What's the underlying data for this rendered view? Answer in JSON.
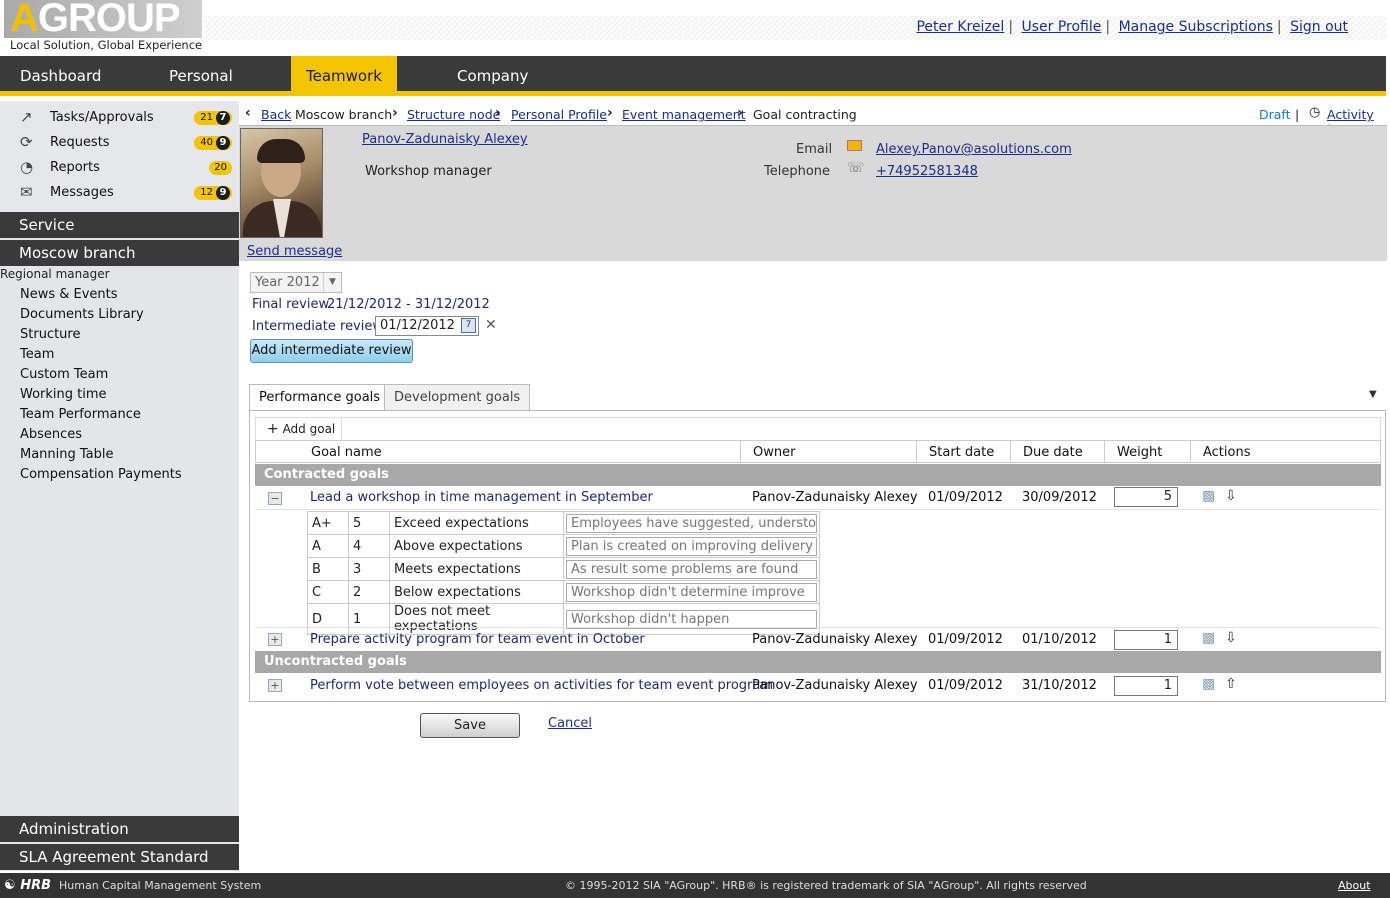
{
  "header": {
    "logo_text": "AGROUP",
    "tagline": "Local Solution, Global Experience",
    "user_links": [
      "Peter Kreizel",
      "User Profile",
      "Manage Subscriptions",
      "Sign out"
    ]
  },
  "nav": {
    "items": [
      "Dashboard",
      "Personal",
      "Teamwork",
      "Company"
    ],
    "active": "Teamwork"
  },
  "sidebar": {
    "quick": [
      {
        "label": "Tasks/Approvals",
        "count": "21",
        "new": "7",
        "icon": "tasks-icon"
      },
      {
        "label": "Requests",
        "count": "40",
        "new": "9",
        "icon": "refresh-icon"
      },
      {
        "label": "Reports",
        "count": "20",
        "new": "",
        "icon": "pie-chart-icon"
      },
      {
        "label": "Messages",
        "count": "12",
        "new": "9",
        "icon": "envelope-icon"
      }
    ],
    "service": "Service",
    "branch": "Moscow branch",
    "role": "Regional manager",
    "links": [
      "News & Events",
      "Documents Library",
      "Structure",
      "Team",
      "Custom Team",
      "Working time",
      "Team Performance",
      "Absences",
      "Manning Table",
      "Compensation Payments"
    ],
    "administration": "Administration",
    "sla": "SLA Agreement Standard"
  },
  "breadcrumb": {
    "back": "Back",
    "items": [
      "Moscow branch",
      "Structure node",
      "Personal Profile",
      "Event management",
      "Goal contracting"
    ],
    "status": "Draft",
    "activity_log": "Activity log"
  },
  "profile": {
    "name": "Panov-Zadunaisky Alexey",
    "position": "Workshop manager",
    "email_label": "Email",
    "email": "Alexey.Panov@asolutions.com",
    "phone_label": "Telephone",
    "phone": "+74952581348",
    "send_message": "Send message"
  },
  "review": {
    "year": "Year 2012",
    "final_label": "Final review",
    "final_range": "21/12/2012 - 31/12/2012",
    "intermediate_label": "Intermediate review",
    "intermediate_date": "01/12/2012",
    "add_button": "Add intermediate review"
  },
  "tabs": [
    "Performance goals",
    "Development goals"
  ],
  "grid": {
    "add_goal": "Add goal",
    "columns": [
      "Goal name",
      "Owner",
      "Start date",
      "Due date",
      "Weight",
      "Actions"
    ],
    "contracted_label": "Contracted goals",
    "uncontracted_label": "Uncontracted goals",
    "goals": [
      {
        "name": "Lead a workshop in time management in September",
        "owner": "Panov-Zadunaisky Alexey",
        "start": "01/09/2012",
        "due": "30/09/2012",
        "weight": "5",
        "expanded": "true",
        "move": "down"
      },
      {
        "name": "Prepare activity program for team event in October",
        "owner": "Panov-Zadunaisky Alexey",
        "start": "01/09/2012",
        "due": "01/10/2012",
        "weight": "1",
        "expanded": "false",
        "move": "down"
      },
      {
        "name": "Perform vote between employees on activities for team event program",
        "owner": "Panov-Zadunaisky Alexey",
        "start": "01/09/2012",
        "due": "31/10/2012",
        "weight": "1",
        "expanded": "false",
        "move": "up"
      }
    ],
    "scale": [
      {
        "grade": "A+",
        "score": "5",
        "text": "Exceed expectations",
        "criteria": "Employees have suggested, understo"
      },
      {
        "grade": "A",
        "score": "4",
        "text": "Above expectations",
        "criteria": "Plan is created on improving delivery"
      },
      {
        "grade": "B",
        "score": "3",
        "text": "Meets expectations",
        "criteria": "As result some problems are found"
      },
      {
        "grade": "C",
        "score": "2",
        "text": "Below expectations",
        "criteria": "Workshop didn't determine improve"
      },
      {
        "grade": "D",
        "score": "1",
        "text": "Does not meet expectations",
        "criteria": "Workshop didn't happen"
      }
    ]
  },
  "actions": {
    "save": "Save",
    "cancel": "Cancel"
  },
  "footer": {
    "brand": "HRB",
    "system": "Human Capital Management System",
    "copyright": "© 1995-2012 SIA \"AGroup\". HRB® is registered trademark of SIA \"AGroup\". All rights reserved",
    "about": "About"
  },
  "colors": {
    "accent": "#f3c400",
    "dark": "#3a3a3a",
    "link": "#1a2f8a"
  }
}
